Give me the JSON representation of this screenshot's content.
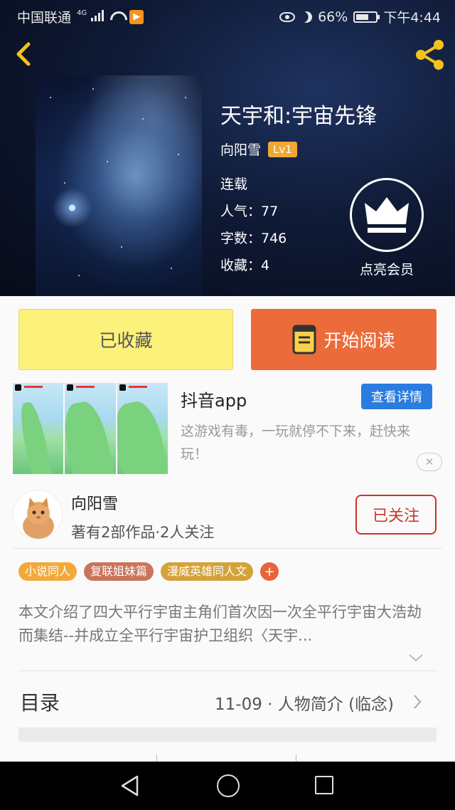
{
  "status_bar": {
    "carrier": "中国联通",
    "network": "4G",
    "battery": "66%",
    "battery_level": 0.66,
    "time": "下午4:44"
  },
  "header": {
    "back_icon": "chevron-left-icon",
    "share_icon": "share-icon"
  },
  "book": {
    "title": "天宇和:宇宙先锋",
    "author": "向阳雪",
    "level": "Lv1",
    "status": "连载",
    "popularity": "人气：77",
    "word_count": "字数：746",
    "favorites": "收藏：4"
  },
  "vip": {
    "icon": "crown-icon",
    "label": "点亮会员"
  },
  "actions": {
    "favorited_label": "已收藏",
    "read_label": "开始阅读"
  },
  "ad": {
    "title": "抖音app",
    "detail_button": "查看详情",
    "description": "这游戏有毒，一玩就停不下来，赶快来玩！",
    "close_icon": "close-icon"
  },
  "author_card": {
    "name": "向阳雪",
    "stats": "著有2部作品·2人关注",
    "follow_label": "已关注"
  },
  "tags": [
    {
      "label": "小说同人",
      "color": "#f3a93a"
    },
    {
      "label": "复联姐妹篇",
      "color": "#c9745b"
    },
    {
      "label": "漫威英雄同人文",
      "color": "#d4a239"
    }
  ],
  "summary": "本文介绍了四大平行宇宙主角们首次因一次全平行宇宙大浩劫而集结--并成立全平行宇宙护卫组织〈天宇...",
  "toc": {
    "title": "目录",
    "latest": "11-09 · 人物简介 (临念)"
  },
  "colors": {
    "fav_button": "#fcf17a",
    "read_button": "#ec6b3a",
    "follow": "#c9352b",
    "detail_button": "#2a7cdf",
    "level_badge": "#f0a833"
  }
}
